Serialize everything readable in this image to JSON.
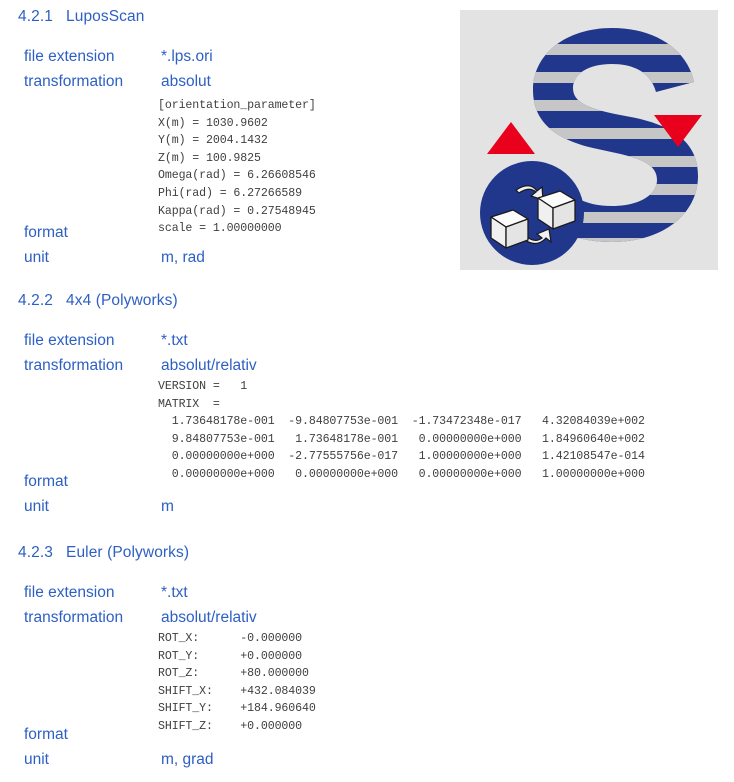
{
  "document": {
    "colors": {
      "text_blue": "#2d5fc4",
      "code_gray": "#404040",
      "logo_blue": "#21378c",
      "logo_red": "#e8001c",
      "logo_stripe": "#c6c6c6",
      "logo_background": "#e3e3e3"
    },
    "labels": {
      "file_extension": "file extension",
      "transformation": "transformation",
      "format": "format",
      "unit": "unit"
    }
  },
  "sections": [
    {
      "number": "4.2.1",
      "title": "LuposScan",
      "file_extension": "*.lps.ori",
      "transformation": "absolut",
      "unit": "m, rad",
      "code": "[orientation_parameter]\nX(m) = 1030.9602\nY(m) = 2004.1432\nZ(m) = 100.9825\nOmega(rad) = 6.26608546\nPhi(rad) = 6.27266589\nKappa(rad) = 0.27548945\nscale = 1.00000000"
    },
    {
      "number": "4.2.2",
      "title": "4x4 (Polyworks)",
      "file_extension": "*.txt",
      "transformation": "absolut/relativ",
      "unit": "m",
      "code": "VERSION =   1\nMATRIX  =\n  1.73648178e-001  -9.84807753e-001  -1.73472348e-017   4.32084039e+002\n  9.84807753e-001   1.73648178e-001   0.00000000e+000   1.84960640e+002\n  0.00000000e+000  -2.77555756e-017   1.00000000e+000   1.42108547e-014\n  0.00000000e+000   0.00000000e+000   0.00000000e+000   1.00000000e+000"
    },
    {
      "number": "4.2.3",
      "title": "Euler (Polyworks)",
      "file_extension": "*.txt",
      "transformation": "absolut/relativ",
      "unit": "m, grad",
      "code": "ROT_X:      -0.000000\nROT_Y:      +0.000000\nROT_Z:      +80.000000\nSHIFT_X:    +432.084039\nSHIFT_Y:    +184.960640\nSHIFT_Z:    +0.000000"
    }
  ],
  "logo": {
    "name": "luposcan-logo",
    "letter": "S",
    "badge": "recycling-cubes-badge",
    "marker_up": "red-triangle-up",
    "marker_down": "red-triangle-down"
  }
}
